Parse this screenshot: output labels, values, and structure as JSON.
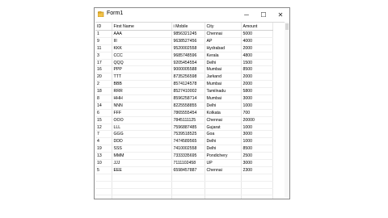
{
  "window": {
    "title": "Form1",
    "min_glyph": "─",
    "max_glyph": "☐",
    "close_glyph": "✕"
  },
  "table": {
    "headers": [
      "ID",
      "First Name",
      "i Mobile",
      "City",
      "Amount"
    ],
    "rows": [
      [
        "1",
        "AAA",
        "9856321245",
        "Chennai",
        "5000"
      ],
      [
        "9",
        "III",
        "9638527456",
        "AP",
        "4000"
      ],
      [
        "11",
        "KKK",
        "9520002558",
        "Hydrabad",
        "2000"
      ],
      [
        "3",
        "CCC",
        "9685748596",
        "Kerala",
        "4800"
      ],
      [
        "17",
        "QQQ",
        "9205454554",
        "Delhi",
        "1500"
      ],
      [
        "16",
        "PPP",
        "9000005588",
        "Mumbai",
        "8500"
      ],
      [
        "20",
        "TTT",
        "8735256598",
        "Jarkand",
        "2000"
      ],
      [
        "2",
        "BBB",
        "8574124578",
        "Mumbai",
        "2000"
      ],
      [
        "18",
        "RRR",
        "8527410002",
        "Tamilnadu",
        "5800"
      ],
      [
        "8",
        "HHH",
        "8596258714",
        "Mumbai",
        "3000"
      ],
      [
        "14",
        "NNN",
        "8225558855",
        "Delhi",
        "1000"
      ],
      [
        "6",
        "FFF",
        "7865555454",
        "Kolkata",
        "700"
      ],
      [
        "15",
        "OOO",
        "7845111125",
        "Chennai",
        "20000"
      ],
      [
        "12",
        "LLL",
        "7596887485",
        "Gujarat",
        "1000"
      ],
      [
        "7",
        "GGG",
        "7539518525",
        "Goa",
        "3000"
      ],
      [
        "4",
        "DDD",
        "7474589565",
        "Delhi",
        "1000"
      ],
      [
        "19",
        "SSS",
        "7410002558",
        "Delhi",
        "8500"
      ],
      [
        "13",
        "MMM",
        "7333335695",
        "Pondichery",
        "2500"
      ],
      [
        "10",
        "JJJ",
        "7111102458",
        "UP",
        "3000"
      ],
      [
        "5",
        "EEE",
        "6598457887",
        "Chennai",
        "2300"
      ]
    ],
    "empty_rows": 5
  }
}
